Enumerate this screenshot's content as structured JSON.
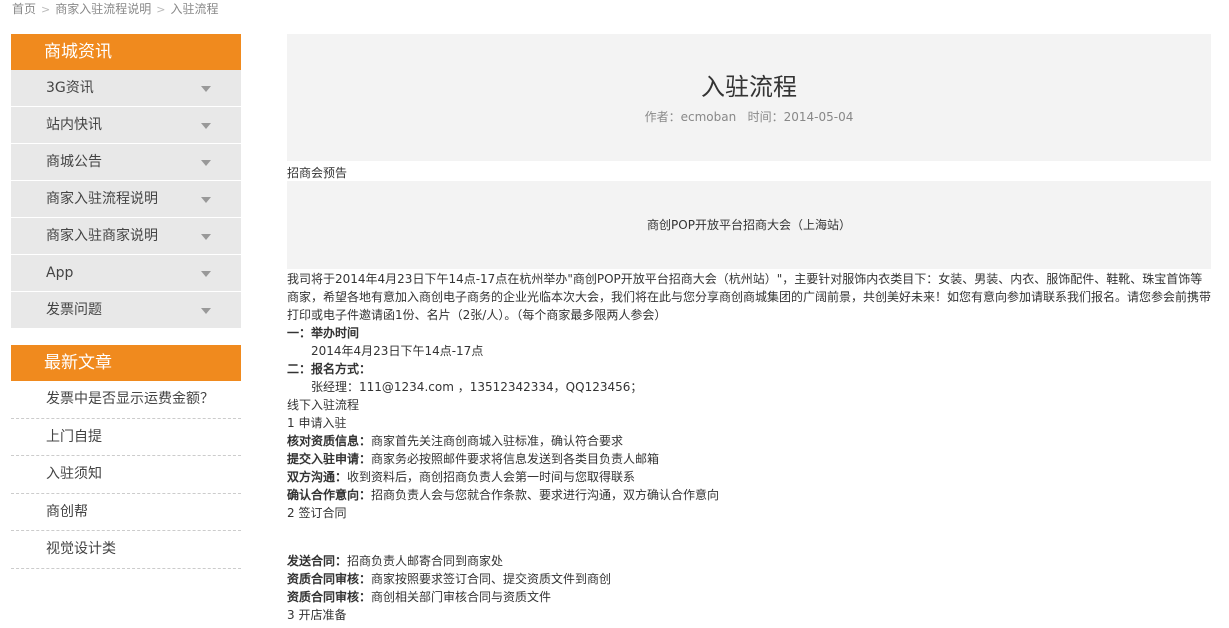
{
  "breadcrumb": {
    "items": [
      "首页",
      "商家入驻流程说明",
      "入驻流程"
    ]
  },
  "sidebar": {
    "news_title": "商城资讯",
    "categories": [
      {
        "label": "3G资讯"
      },
      {
        "label": "站内快讯"
      },
      {
        "label": "商城公告"
      },
      {
        "label": "商家入驻流程说明"
      },
      {
        "label": "商家入驻商家说明"
      },
      {
        "label": "App"
      },
      {
        "label": "发票问题"
      }
    ],
    "latest_title": "最新文章",
    "articles": [
      {
        "label": "发票中是否显示运费金额？"
      },
      {
        "label": "上门自提"
      },
      {
        "label": "入驻须知"
      },
      {
        "label": "商创帮"
      },
      {
        "label": "视觉设计类"
      }
    ]
  },
  "article": {
    "title": "入驻流程",
    "meta": "作者：ecmoban   时间：2014-05-04",
    "preview_label": "招商会预告",
    "notice": "商创POP开放平台招商大会（上海站）",
    "intro": "我司将于2014年4月23日下午14点-17点在杭州举办\"商创POP开放平台招商大会（杭州站）\"，主要针对服饰内衣类目下：女装、男装、内衣、服饰配件、鞋靴、珠宝首饰等商家，希望各地有意加入商创电子商务的企业光临本次大会，我们将在此与您分享商创商城集团的广阔前景，共创美好未来！如您有意向参加请联系我们报名。请您参会前携带打印或电子件邀请函1份、名片（2张/人）。（每个商家最多限两人参会）",
    "sec1_title": "一：举办时间",
    "sec1_text": "2014年4月23日下午14点-17点",
    "sec2_title": "二：报名方式：",
    "sec2_text": "张经理：111@1234.com ，13512342334，QQ123456；",
    "offline_title": "线下入驻流程",
    "step1": "1 申请入驻",
    "l1_label": "核对资质信息：",
    "l1_text": "商家首先关注商创商城入驻标准，确认符合要求",
    "l2_label": "提交入驻申请：",
    "l2_text": "商家务必按照邮件要求将信息发送到各类目负责人邮箱",
    "l3_label": "双方沟通：",
    "l3_text": "收到资料后，商创招商负责人会第一时间与您取得联系",
    "l4_label": "确认合作意向：",
    "l4_text": "招商负责人会与您就合作条款、要求进行沟通，双方确认合作意向",
    "step2": "2 签订合同",
    "l5_label": "发送合同：",
    "l5_text": "招商负责人邮寄合同到商家处",
    "l6_label": "资质合同审核：",
    "l6_text": "商家按照要求签订合同、提交资质文件到商创",
    "l7_label": "资质合同审核：",
    "l7_text": "商创相关部门审核合同与资质文件",
    "step3": "3 开店准备"
  }
}
